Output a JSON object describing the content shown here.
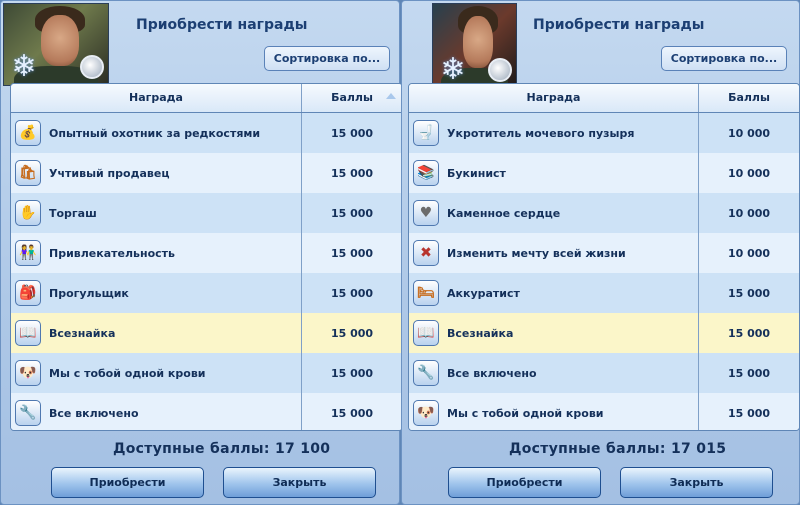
{
  "left": {
    "title": "Приобрести награды",
    "sort_label": "Сортировка по...",
    "col_reward": "Награда",
    "col_points": "Баллы",
    "rows": [
      {
        "name": "Опытный охотник за редкостями",
        "points": "15 000",
        "icon": "treasure-bag-icon"
      },
      {
        "name": "Учтивый продавец",
        "points": "15 000",
        "icon": "shop-seller-icon"
      },
      {
        "name": "Торгаш",
        "points": "15 000",
        "icon": "haggle-hand-icon"
      },
      {
        "name": "Привлекательность",
        "points": "15 000",
        "icon": "couple-icon"
      },
      {
        "name": "Прогульщик",
        "points": "15 000",
        "icon": "skipping-school-icon"
      },
      {
        "name": "Всезнайка",
        "points": "15 000",
        "icon": "book-icon",
        "selected": true
      },
      {
        "name": "Мы с тобой одной крови",
        "points": "15 000",
        "icon": "dog-face-icon"
      },
      {
        "name": "Все включено",
        "points": "15 000",
        "icon": "wrench-icon"
      }
    ],
    "balance": "Доступные баллы: 17 100",
    "buy_label": "Приобрести",
    "close_label": "Закрыть"
  },
  "right": {
    "title": "Приобрести награды",
    "sort_label": "Сортировка по...",
    "col_reward": "Награда",
    "col_points": "Баллы",
    "rows": [
      {
        "name": "Укротитель мочевого пузыря",
        "points": "10 000",
        "icon": "toilet-icon"
      },
      {
        "name": "Букинист",
        "points": "10 000",
        "icon": "bookshelf-icon"
      },
      {
        "name": "Каменное сердце",
        "points": "10 000",
        "icon": "stone-heart-icon"
      },
      {
        "name": "Изменить мечту всей жизни",
        "points": "10 000",
        "icon": "change-dream-icon"
      },
      {
        "name": "Аккуратист",
        "points": "15 000",
        "icon": "clean-bed-icon"
      },
      {
        "name": "Всезнайка",
        "points": "15 000",
        "icon": "book-icon",
        "selected": true
      },
      {
        "name": "Все включено",
        "points": "15 000",
        "icon": "wrench-icon"
      },
      {
        "name": "Мы с тобой одной крови",
        "points": "15 000",
        "icon": "dog-face-icon"
      }
    ],
    "balance": "Доступные баллы: 17 015",
    "buy_label": "Приобрести",
    "close_label": "Закрыть"
  }
}
